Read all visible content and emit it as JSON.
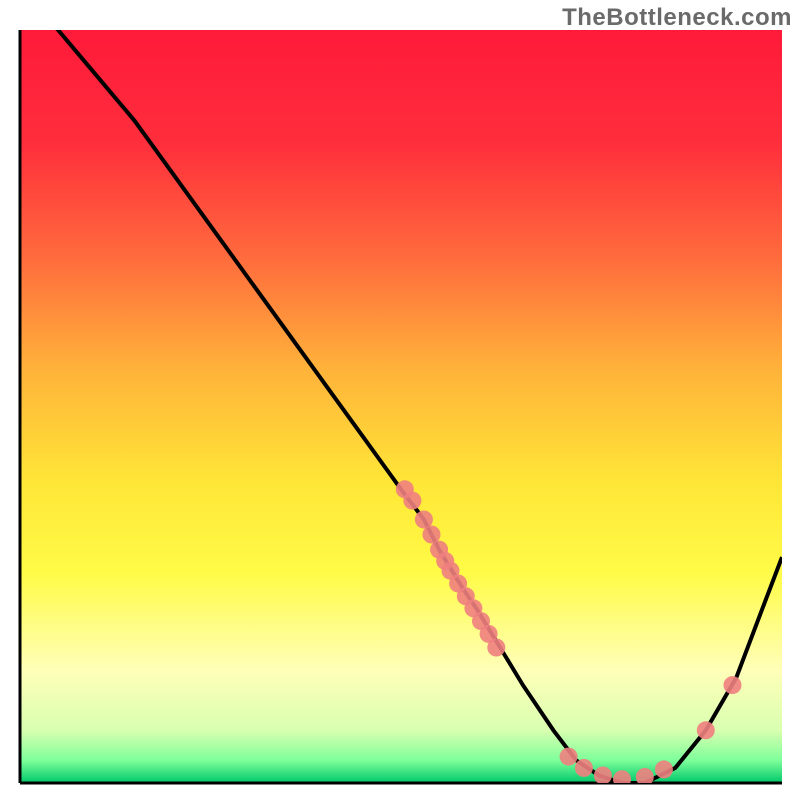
{
  "attribution": "TheBottleneck.com",
  "chart_data": {
    "type": "line",
    "title": "",
    "xlabel": "",
    "ylabel": "",
    "xlim": [
      0,
      100
    ],
    "ylim": [
      0,
      100
    ],
    "grid": false,
    "legend": false,
    "background_gradient": {
      "stops": [
        {
          "offset": 0.0,
          "color": "#ff1a3a"
        },
        {
          "offset": 0.15,
          "color": "#ff2e3c"
        },
        {
          "offset": 0.3,
          "color": "#ff6a3d"
        },
        {
          "offset": 0.45,
          "color": "#ffb23a"
        },
        {
          "offset": 0.6,
          "color": "#ffe637"
        },
        {
          "offset": 0.72,
          "color": "#fffb46"
        },
        {
          "offset": 0.85,
          "color": "#ffffb8"
        },
        {
          "offset": 0.93,
          "color": "#d9ffb0"
        },
        {
          "offset": 0.97,
          "color": "#7dff9a"
        },
        {
          "offset": 1.0,
          "color": "#00c76a"
        }
      ]
    },
    "series": [
      {
        "name": "curve",
        "color": "#000000",
        "x": [
          0,
          5,
          10,
          15,
          20,
          25,
          30,
          35,
          40,
          45,
          50,
          53,
          55,
          58,
          60,
          63,
          66,
          70,
          73,
          76,
          79,
          82,
          86,
          90,
          94,
          97,
          100
        ],
        "y": [
          105,
          100,
          94,
          88,
          81,
          74,
          67,
          60,
          53,
          46,
          39,
          35,
          31,
          26,
          23,
          18,
          13,
          7,
          3,
          1,
          0,
          0,
          2,
          7,
          14,
          22,
          30
        ]
      }
    ],
    "scatter": [
      {
        "name": "marker-cluster-upper",
        "color": "#f08080",
        "points": [
          {
            "x": 50.5,
            "y": 39.0
          },
          {
            "x": 51.5,
            "y": 37.5
          },
          {
            "x": 53.0,
            "y": 35.0
          },
          {
            "x": 54.0,
            "y": 33.0
          },
          {
            "x": 55.0,
            "y": 31.0
          },
          {
            "x": 55.8,
            "y": 29.5
          },
          {
            "x": 56.5,
            "y": 28.2
          },
          {
            "x": 57.5,
            "y": 26.5
          },
          {
            "x": 58.5,
            "y": 24.8
          },
          {
            "x": 59.5,
            "y": 23.2
          },
          {
            "x": 60.5,
            "y": 21.5
          },
          {
            "x": 61.5,
            "y": 19.8
          },
          {
            "x": 62.5,
            "y": 18.0
          }
        ]
      },
      {
        "name": "marker-cluster-valley",
        "color": "#f08080",
        "points": [
          {
            "x": 72.0,
            "y": 3.5
          },
          {
            "x": 74.0,
            "y": 2.0
          },
          {
            "x": 76.5,
            "y": 1.0
          },
          {
            "x": 79.0,
            "y": 0.5
          },
          {
            "x": 82.0,
            "y": 0.8
          },
          {
            "x": 84.5,
            "y": 1.8
          }
        ]
      },
      {
        "name": "marker-cluster-right",
        "color": "#f08080",
        "points": [
          {
            "x": 90.0,
            "y": 7.0
          },
          {
            "x": 93.5,
            "y": 13.0
          }
        ]
      }
    ]
  }
}
